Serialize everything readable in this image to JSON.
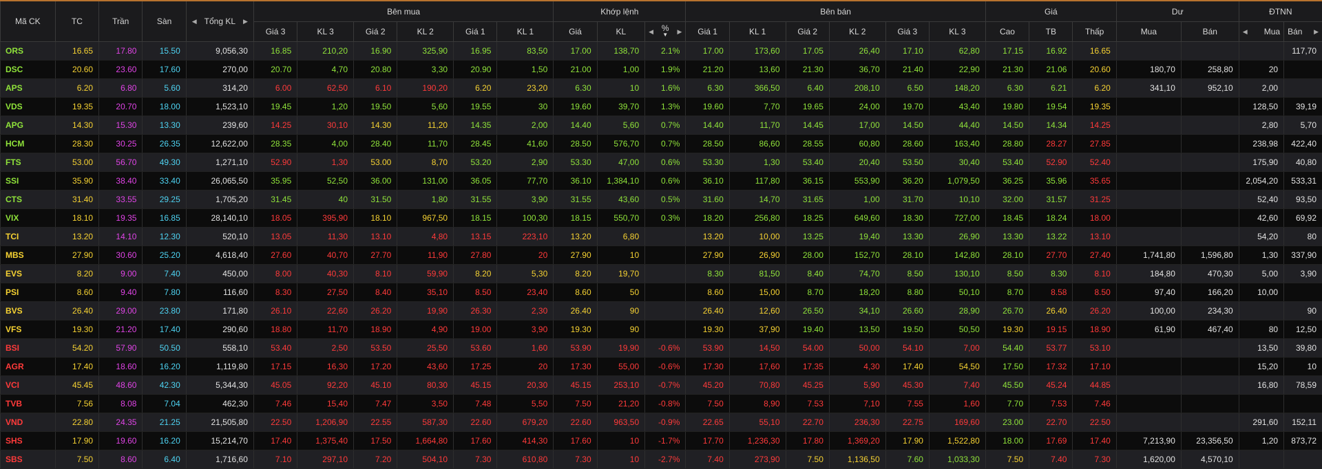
{
  "colors": {
    "up": "#8fe23a",
    "down": "#ff3a3a",
    "ref": "#f6d232",
    "ceil": "#e044e6",
    "floor": "#4ed3f2",
    "neutral": "#e2e2e2"
  },
  "header": {
    "groups": {
      "ben_mua": "Bên mua",
      "khop_lenh": "Khớp lệnh",
      "ben_ban": "Bên bán",
      "gia": "Giá",
      "du": "Dư",
      "dtnn": "ĐTNN"
    },
    "columns": {
      "ma_ck": "Mã CK",
      "tc": "TC",
      "tran": "Trần",
      "san": "Sàn",
      "tong_kl": "Tổng KL",
      "gia3_mua": "Giá 3",
      "kl3_mua": "KL 3",
      "gia2_mua": "Giá 2",
      "kl2_mua": "KL 2",
      "gia1_mua": "Giá 1",
      "kl1_mua": "KL 1",
      "khop_gia": "Giá",
      "khop_kl": "KL",
      "khop_pct": "%",
      "gia1_ban": "Giá 1",
      "kl1_ban": "KL 1",
      "gia2_ban": "Giá 2",
      "kl2_ban": "KL 2",
      "gia3_ban": "Giá 3",
      "kl3_ban": "KL 3",
      "cao": "Cao",
      "tb": "TB",
      "thap": "Thấp",
      "du_mua": "Mua",
      "du_ban": "Bán",
      "nn_mua": "Mua",
      "nn_ban": "Bán"
    }
  },
  "rows": [
    {
      "sym": "ORS",
      "sc": "u",
      "tc": "16.65",
      "tran": "17.80",
      "san": "15.50",
      "tong": "9,056,30",
      "b3": "16.85",
      "b3c": "u",
      "bk3": "210,20",
      "b2": "16.90",
      "b2c": "u",
      "bk2": "325,90",
      "b1": "16.95",
      "b1c": "u",
      "bk1": "83,50",
      "mg": "17.00",
      "mc": "u",
      "mk": "138,70",
      "pct": "2.1%",
      "s1": "17.00",
      "s1c": "u",
      "sk1": "173,60",
      "s2": "17.05",
      "s2c": "u",
      "sk2": "26,40",
      "s3": "17.10",
      "s3c": "u",
      "sk3": "62,80",
      "cao": "17.15",
      "caoc": "u",
      "tb": "16.92",
      "tbc": "u",
      "thap": "16.65",
      "thapc": "r",
      "dm": "",
      "db": "",
      "nm": "",
      "nb": "117,70"
    },
    {
      "sym": "DSC",
      "sc": "u",
      "tc": "20.60",
      "tran": "23.60",
      "san": "17.60",
      "tong": "270,00",
      "b3": "20.70",
      "b3c": "u",
      "bk3": "4,70",
      "b2": "20.80",
      "b2c": "u",
      "bk2": "3,30",
      "b1": "20.90",
      "b1c": "u",
      "bk1": "1,50",
      "mg": "21.00",
      "mc": "u",
      "mk": "1,00",
      "pct": "1.9%",
      "s1": "21.20",
      "s1c": "u",
      "sk1": "13,60",
      "s2": "21.30",
      "s2c": "u",
      "sk2": "36,70",
      "s3": "21.40",
      "s3c": "u",
      "sk3": "22,90",
      "cao": "21.30",
      "caoc": "u",
      "tb": "21.06",
      "tbc": "u",
      "thap": "20.60",
      "thapc": "r",
      "dm": "180,70",
      "db": "258,80",
      "nm": "20",
      "nb": ""
    },
    {
      "sym": "APS",
      "sc": "u",
      "tc": "6.20",
      "tran": "6.80",
      "san": "5.60",
      "tong": "314,20",
      "b3": "6.00",
      "b3c": "d",
      "bk3": "62,50",
      "b2": "6.10",
      "b2c": "d",
      "bk2": "190,20",
      "b1": "6.20",
      "b1c": "r",
      "bk1": "23,20",
      "mg": "6.30",
      "mc": "u",
      "mk": "10",
      "pct": "1.6%",
      "s1": "6.30",
      "s1c": "u",
      "sk1": "366,50",
      "s2": "6.40",
      "s2c": "u",
      "sk2": "208,10",
      "s3": "6.50",
      "s3c": "u",
      "sk3": "148,20",
      "cao": "6.30",
      "caoc": "u",
      "tb": "6.21",
      "tbc": "u",
      "thap": "6.20",
      "thapc": "r",
      "dm": "341,10",
      "db": "952,10",
      "nm": "2,00",
      "nb": ""
    },
    {
      "sym": "VDS",
      "sc": "u",
      "tc": "19.35",
      "tran": "20.70",
      "san": "18.00",
      "tong": "1,523,10",
      "b3": "19.45",
      "b3c": "u",
      "bk3": "1,20",
      "b2": "19.50",
      "b2c": "u",
      "bk2": "5,60",
      "b1": "19.55",
      "b1c": "u",
      "bk1": "30",
      "mg": "19.60",
      "mc": "u",
      "mk": "39,70",
      "pct": "1.3%",
      "s1": "19.60",
      "s1c": "u",
      "sk1": "7,70",
      "s2": "19.65",
      "s2c": "u",
      "sk2": "24,00",
      "s3": "19.70",
      "s3c": "u",
      "sk3": "43,40",
      "cao": "19.80",
      "caoc": "u",
      "tb": "19.54",
      "tbc": "u",
      "thap": "19.35",
      "thapc": "r",
      "dm": "",
      "db": "",
      "nm": "128,50",
      "nb": "39,19"
    },
    {
      "sym": "APG",
      "sc": "u",
      "tc": "14.30",
      "tran": "15.30",
      "san": "13.30",
      "tong": "239,60",
      "b3": "14.25",
      "b3c": "d",
      "bk3": "30,10",
      "b2": "14.30",
      "b2c": "r",
      "bk2": "11,20",
      "b1": "14.35",
      "b1c": "u",
      "bk1": "2,00",
      "mg": "14.40",
      "mc": "u",
      "mk": "5,60",
      "pct": "0.7%",
      "s1": "14.40",
      "s1c": "u",
      "sk1": "11,70",
      "s2": "14.45",
      "s2c": "u",
      "sk2": "17,00",
      "s3": "14.50",
      "s3c": "u",
      "sk3": "44,40",
      "cao": "14.50",
      "caoc": "u",
      "tb": "14.34",
      "tbc": "u",
      "thap": "14.25",
      "thapc": "d",
      "dm": "",
      "db": "",
      "nm": "2,80",
      "nb": "5,70"
    },
    {
      "sym": "HCM",
      "sc": "u",
      "tc": "28.30",
      "tran": "30.25",
      "san": "26.35",
      "tong": "12,622,00",
      "b3": "28.35",
      "b3c": "u",
      "bk3": "4,00",
      "b2": "28.40",
      "b2c": "u",
      "bk2": "11,70",
      "b1": "28.45",
      "b1c": "u",
      "bk1": "41,60",
      "mg": "28.50",
      "mc": "u",
      "mk": "576,70",
      "pct": "0.7%",
      "s1": "28.50",
      "s1c": "u",
      "sk1": "86,60",
      "s2": "28.55",
      "s2c": "u",
      "sk2": "60,80",
      "s3": "28.60",
      "s3c": "u",
      "sk3": "163,40",
      "cao": "28.80",
      "caoc": "u",
      "tb": "28.27",
      "tbc": "d",
      "thap": "27.85",
      "thapc": "d",
      "dm": "",
      "db": "",
      "nm": "238,98",
      "nb": "422,40"
    },
    {
      "sym": "FTS",
      "sc": "u",
      "tc": "53.00",
      "tran": "56.70",
      "san": "49.30",
      "tong": "1,271,10",
      "b3": "52.90",
      "b3c": "d",
      "bk3": "1,30",
      "b2": "53.00",
      "b2c": "r",
      "bk2": "8,70",
      "b1": "53.20",
      "b1c": "u",
      "bk1": "2,90",
      "mg": "53.30",
      "mc": "u",
      "mk": "47,00",
      "pct": "0.6%",
      "s1": "53.30",
      "s1c": "u",
      "sk1": "1,30",
      "s2": "53.40",
      "s2c": "u",
      "sk2": "20,40",
      "s3": "53.50",
      "s3c": "u",
      "sk3": "30,40",
      "cao": "53.40",
      "caoc": "u",
      "tb": "52.90",
      "tbc": "d",
      "thap": "52.40",
      "thapc": "d",
      "dm": "",
      "db": "",
      "nm": "175,90",
      "nb": "40,80"
    },
    {
      "sym": "SSI",
      "sc": "u",
      "tc": "35.90",
      "tran": "38.40",
      "san": "33.40",
      "tong": "26,065,50",
      "b3": "35.95",
      "b3c": "u",
      "bk3": "52,50",
      "b2": "36.00",
      "b2c": "u",
      "bk2": "131,00",
      "b1": "36.05",
      "b1c": "u",
      "bk1": "77,70",
      "mg": "36.10",
      "mc": "u",
      "mk": "1,384,10",
      "pct": "0.6%",
      "s1": "36.10",
      "s1c": "u",
      "sk1": "117,80",
      "s2": "36.15",
      "s2c": "u",
      "sk2": "553,90",
      "s3": "36.20",
      "s3c": "u",
      "sk3": "1,079,50",
      "cao": "36.25",
      "caoc": "u",
      "tb": "35.96",
      "tbc": "u",
      "thap": "35.65",
      "thapc": "d",
      "dm": "",
      "db": "",
      "nm": "2,054,20",
      "nb": "533,31"
    },
    {
      "sym": "CTS",
      "sc": "u",
      "tc": "31.40",
      "tran": "33.55",
      "san": "29.25",
      "tong": "1,705,20",
      "b3": "31.45",
      "b3c": "u",
      "bk3": "40",
      "b2": "31.50",
      "b2c": "u",
      "bk2": "1,80",
      "b1": "31.55",
      "b1c": "u",
      "bk1": "3,90",
      "mg": "31.55",
      "mc": "u",
      "mk": "43,60",
      "pct": "0.5%",
      "s1": "31.60",
      "s1c": "u",
      "sk1": "14,70",
      "s2": "31.65",
      "s2c": "u",
      "sk2": "1,00",
      "s3": "31.70",
      "s3c": "u",
      "sk3": "10,10",
      "cao": "32.00",
      "caoc": "u",
      "tb": "31.57",
      "tbc": "u",
      "thap": "31.25",
      "thapc": "d",
      "dm": "",
      "db": "",
      "nm": "52,40",
      "nb": "93,50"
    },
    {
      "sym": "VIX",
      "sc": "u",
      "tc": "18.10",
      "tran": "19.35",
      "san": "16.85",
      "tong": "28,140,10",
      "b3": "18.05",
      "b3c": "d",
      "bk3": "395,90",
      "b2": "18.10",
      "b2c": "r",
      "bk2": "967,50",
      "b1": "18.15",
      "b1c": "u",
      "bk1": "100,30",
      "mg": "18.15",
      "mc": "u",
      "mk": "550,70",
      "pct": "0.3%",
      "s1": "18.20",
      "s1c": "u",
      "sk1": "256,80",
      "s2": "18.25",
      "s2c": "u",
      "sk2": "649,60",
      "s3": "18.30",
      "s3c": "u",
      "sk3": "727,00",
      "cao": "18.45",
      "caoc": "u",
      "tb": "18.24",
      "tbc": "u",
      "thap": "18.00",
      "thapc": "d",
      "dm": "",
      "db": "",
      "nm": "42,60",
      "nb": "69,92"
    },
    {
      "sym": "TCI",
      "sc": "r",
      "tc": "13.20",
      "tran": "14.10",
      "san": "12.30",
      "tong": "520,10",
      "b3": "13.05",
      "b3c": "d",
      "bk3": "11,30",
      "b2": "13.10",
      "b2c": "d",
      "bk2": "4,80",
      "b1": "13.15",
      "b1c": "d",
      "bk1": "223,10",
      "mg": "13.20",
      "mc": "r",
      "mk": "6,80",
      "pct": "",
      "s1": "13.20",
      "s1c": "r",
      "sk1": "10,00",
      "s2": "13.25",
      "s2c": "u",
      "sk2": "19,40",
      "s3": "13.30",
      "s3c": "u",
      "sk3": "26,90",
      "cao": "13.30",
      "caoc": "u",
      "tb": "13.22",
      "tbc": "u",
      "thap": "13.10",
      "thapc": "d",
      "dm": "",
      "db": "",
      "nm": "54,20",
      "nb": "80"
    },
    {
      "sym": "MBS",
      "sc": "r",
      "tc": "27.90",
      "tran": "30.60",
      "san": "25.20",
      "tong": "4,618,40",
      "b3": "27.60",
      "b3c": "d",
      "bk3": "40,70",
      "b2": "27.70",
      "b2c": "d",
      "bk2": "11,90",
      "b1": "27.80",
      "b1c": "d",
      "bk1": "20",
      "mg": "27.90",
      "mc": "r",
      "mk": "10",
      "pct": "",
      "s1": "27.90",
      "s1c": "r",
      "sk1": "26,90",
      "s2": "28.00",
      "s2c": "u",
      "sk2": "152,70",
      "s3": "28.10",
      "s3c": "u",
      "sk3": "142,80",
      "cao": "28.10",
      "caoc": "u",
      "tb": "27.70",
      "tbc": "d",
      "thap": "27.40",
      "thapc": "d",
      "dm": "1,741,80",
      "db": "1,596,80",
      "nm": "1,30",
      "nb": "337,90"
    },
    {
      "sym": "EVS",
      "sc": "r",
      "tc": "8.20",
      "tran": "9.00",
      "san": "7.40",
      "tong": "450,00",
      "b3": "8.00",
      "b3c": "d",
      "bk3": "40,30",
      "b2": "8.10",
      "b2c": "d",
      "bk2": "59,90",
      "b1": "8.20",
      "b1c": "r",
      "bk1": "5,30",
      "mg": "8.20",
      "mc": "r",
      "mk": "19,70",
      "pct": "",
      "s1": "8.30",
      "s1c": "u",
      "sk1": "81,50",
      "s2": "8.40",
      "s2c": "u",
      "sk2": "74,70",
      "s3": "8.50",
      "s3c": "u",
      "sk3": "130,10",
      "cao": "8.50",
      "caoc": "u",
      "tb": "8.30",
      "tbc": "u",
      "thap": "8.10",
      "thapc": "d",
      "dm": "184,80",
      "db": "470,30",
      "nm": "5,00",
      "nb": "3,90"
    },
    {
      "sym": "PSI",
      "sc": "r",
      "tc": "8.60",
      "tran": "9.40",
      "san": "7.80",
      "tong": "116,60",
      "b3": "8.30",
      "b3c": "d",
      "bk3": "27,50",
      "b2": "8.40",
      "b2c": "d",
      "bk2": "35,10",
      "b1": "8.50",
      "b1c": "d",
      "bk1": "23,40",
      "mg": "8.60",
      "mc": "r",
      "mk": "50",
      "pct": "",
      "s1": "8.60",
      "s1c": "r",
      "sk1": "15,00",
      "s2": "8.70",
      "s2c": "u",
      "sk2": "18,20",
      "s3": "8.80",
      "s3c": "u",
      "sk3": "50,10",
      "cao": "8.70",
      "caoc": "u",
      "tb": "8.58",
      "tbc": "d",
      "thap": "8.50",
      "thapc": "d",
      "dm": "97,40",
      "db": "166,20",
      "nm": "10,00",
      "nb": ""
    },
    {
      "sym": "BVS",
      "sc": "r",
      "tc": "26.40",
      "tran": "29.00",
      "san": "23.80",
      "tong": "171,80",
      "b3": "26.10",
      "b3c": "d",
      "bk3": "22,60",
      "b2": "26.20",
      "b2c": "d",
      "bk2": "19,90",
      "b1": "26.30",
      "b1c": "d",
      "bk1": "2,30",
      "mg": "26.40",
      "mc": "r",
      "mk": "90",
      "pct": "",
      "s1": "26.40",
      "s1c": "r",
      "sk1": "12,60",
      "s2": "26.50",
      "s2c": "u",
      "sk2": "34,10",
      "s3": "26.60",
      "s3c": "u",
      "sk3": "28,90",
      "cao": "26.70",
      "caoc": "u",
      "tb": "26.40",
      "tbc": "r",
      "thap": "26.20",
      "thapc": "d",
      "dm": "100,00",
      "db": "234,30",
      "nm": "",
      "nb": "90"
    },
    {
      "sym": "VFS",
      "sc": "r",
      "tc": "19.30",
      "tran": "21.20",
      "san": "17.40",
      "tong": "290,60",
      "b3": "18.80",
      "b3c": "d",
      "bk3": "11,70",
      "b2": "18.90",
      "b2c": "d",
      "bk2": "4,90",
      "b1": "19.00",
      "b1c": "d",
      "bk1": "3,90",
      "mg": "19.30",
      "mc": "r",
      "mk": "90",
      "pct": "",
      "s1": "19.30",
      "s1c": "r",
      "sk1": "37,90",
      "s2": "19.40",
      "s2c": "u",
      "sk2": "13,50",
      "s3": "19.50",
      "s3c": "u",
      "sk3": "50,50",
      "cao": "19.30",
      "caoc": "r",
      "tb": "19.15",
      "tbc": "d",
      "thap": "18.90",
      "thapc": "d",
      "dm": "61,90",
      "db": "467,40",
      "nm": "80",
      "nb": "12,50"
    },
    {
      "sym": "BSI",
      "sc": "d",
      "tc": "54.20",
      "tran": "57.90",
      "san": "50.50",
      "tong": "558,10",
      "b3": "53.40",
      "b3c": "d",
      "bk3": "2,50",
      "b2": "53.50",
      "b2c": "d",
      "bk2": "25,50",
      "b1": "53.60",
      "b1c": "d",
      "bk1": "1,60",
      "mg": "53.90",
      "mc": "d",
      "mk": "19,90",
      "pct": "-0.6%",
      "s1": "53.90",
      "s1c": "d",
      "sk1": "14,50",
      "s2": "54.00",
      "s2c": "d",
      "sk2": "50,00",
      "s3": "54.10",
      "s3c": "d",
      "sk3": "7,00",
      "cao": "54.40",
      "caoc": "u",
      "tb": "53.77",
      "tbc": "d",
      "thap": "53.10",
      "thapc": "d",
      "dm": "",
      "db": "",
      "nm": "13,50",
      "nb": "39,80"
    },
    {
      "sym": "AGR",
      "sc": "d",
      "tc": "17.40",
      "tran": "18.60",
      "san": "16.20",
      "tong": "1,119,80",
      "b3": "17.15",
      "b3c": "d",
      "bk3": "16,30",
      "b2": "17.20",
      "b2c": "d",
      "bk2": "43,60",
      "b1": "17.25",
      "b1c": "d",
      "bk1": "20",
      "mg": "17.30",
      "mc": "d",
      "mk": "55,00",
      "pct": "-0.6%",
      "s1": "17.30",
      "s1c": "d",
      "sk1": "17,60",
      "s2": "17.35",
      "s2c": "d",
      "sk2": "4,30",
      "s3": "17.40",
      "s3c": "r",
      "sk3": "54,50",
      "cao": "17.50",
      "caoc": "u",
      "tb": "17.32",
      "tbc": "d",
      "thap": "17.10",
      "thapc": "d",
      "dm": "",
      "db": "",
      "nm": "15,20",
      "nb": "10"
    },
    {
      "sym": "VCI",
      "sc": "d",
      "tc": "45.45",
      "tran": "48.60",
      "san": "42.30",
      "tong": "5,344,30",
      "b3": "45.05",
      "b3c": "d",
      "bk3": "92,20",
      "b2": "45.10",
      "b2c": "d",
      "bk2": "80,30",
      "b1": "45.15",
      "b1c": "d",
      "bk1": "20,30",
      "mg": "45.15",
      "mc": "d",
      "mk": "253,10",
      "pct": "-0.7%",
      "s1": "45.20",
      "s1c": "d",
      "sk1": "70,80",
      "s2": "45.25",
      "s2c": "d",
      "sk2": "5,90",
      "s3": "45.30",
      "s3c": "d",
      "sk3": "7,40",
      "cao": "45.50",
      "caoc": "u",
      "tb": "45.24",
      "tbc": "d",
      "thap": "44.85",
      "thapc": "d",
      "dm": "",
      "db": "",
      "nm": "16,80",
      "nb": "78,59"
    },
    {
      "sym": "TVB",
      "sc": "d",
      "tc": "7.56",
      "tran": "8.08",
      "san": "7.04",
      "tong": "462,30",
      "b3": "7.46",
      "b3c": "d",
      "bk3": "15,40",
      "b2": "7.47",
      "b2c": "d",
      "bk2": "3,50",
      "b1": "7.48",
      "b1c": "d",
      "bk1": "5,50",
      "mg": "7.50",
      "mc": "d",
      "mk": "21,20",
      "pct": "-0.8%",
      "s1": "7.50",
      "s1c": "d",
      "sk1": "8,90",
      "s2": "7.53",
      "s2c": "d",
      "sk2": "7,10",
      "s3": "7.55",
      "s3c": "d",
      "sk3": "1,60",
      "cao": "7.70",
      "caoc": "u",
      "tb": "7.53",
      "tbc": "d",
      "thap": "7.46",
      "thapc": "d",
      "dm": "",
      "db": "",
      "nm": "",
      "nb": ""
    },
    {
      "sym": "VND",
      "sc": "d",
      "tc": "22.80",
      "tran": "24.35",
      "san": "21.25",
      "tong": "21,505,80",
      "b3": "22.50",
      "b3c": "d",
      "bk3": "1,206,90",
      "b2": "22.55",
      "b2c": "d",
      "bk2": "587,30",
      "b1": "22.60",
      "b1c": "d",
      "bk1": "679,20",
      "mg": "22.60",
      "mc": "d",
      "mk": "963,50",
      "pct": "-0.9%",
      "s1": "22.65",
      "s1c": "d",
      "sk1": "55,10",
      "s2": "22.70",
      "s2c": "d",
      "sk2": "236,30",
      "s3": "22.75",
      "s3c": "d",
      "sk3": "169,60",
      "cao": "23.00",
      "caoc": "u",
      "tb": "22.70",
      "tbc": "d",
      "thap": "22.50",
      "thapc": "d",
      "dm": "",
      "db": "",
      "nm": "291,60",
      "nb": "152,11"
    },
    {
      "sym": "SHS",
      "sc": "d",
      "tc": "17.90",
      "tran": "19.60",
      "san": "16.20",
      "tong": "15,214,70",
      "b3": "17.40",
      "b3c": "d",
      "bk3": "1,375,40",
      "b2": "17.50",
      "b2c": "d",
      "bk2": "1,664,80",
      "b1": "17.60",
      "b1c": "d",
      "bk1": "414,30",
      "mg": "17.60",
      "mc": "d",
      "mk": "10",
      "pct": "-1.7%",
      "s1": "17.70",
      "s1c": "d",
      "sk1": "1,236,30",
      "s2": "17.80",
      "s2c": "d",
      "sk2": "1,369,20",
      "s3": "17.90",
      "s3c": "r",
      "sk3": "1,522,80",
      "cao": "18.00",
      "caoc": "u",
      "tb": "17.69",
      "tbc": "d",
      "thap": "17.40",
      "thapc": "d",
      "dm": "7,213,90",
      "db": "23,356,50",
      "nm": "1,20",
      "nb": "873,72"
    },
    {
      "sym": "SBS",
      "sc": "d",
      "tc": "7.50",
      "tran": "8.60",
      "san": "6.40",
      "tong": "1,716,60",
      "b3": "7.10",
      "b3c": "d",
      "bk3": "297,10",
      "b2": "7.20",
      "b2c": "d",
      "bk2": "504,10",
      "b1": "7.30",
      "b1c": "d",
      "bk1": "610,80",
      "mg": "7.30",
      "mc": "d",
      "mk": "10",
      "pct": "-2.7%",
      "s1": "7.40",
      "s1c": "d",
      "sk1": "273,90",
      "s2": "7.50",
      "s2c": "r",
      "sk2": "1,136,50",
      "s3": "7.60",
      "s3c": "u",
      "sk3": "1,033,30",
      "cao": "7.50",
      "caoc": "r",
      "tb": "7.40",
      "tbc": "d",
      "thap": "7.30",
      "thapc": "d",
      "dm": "1,620,00",
      "db": "4,570,10",
      "nm": "",
      "nb": ""
    }
  ]
}
